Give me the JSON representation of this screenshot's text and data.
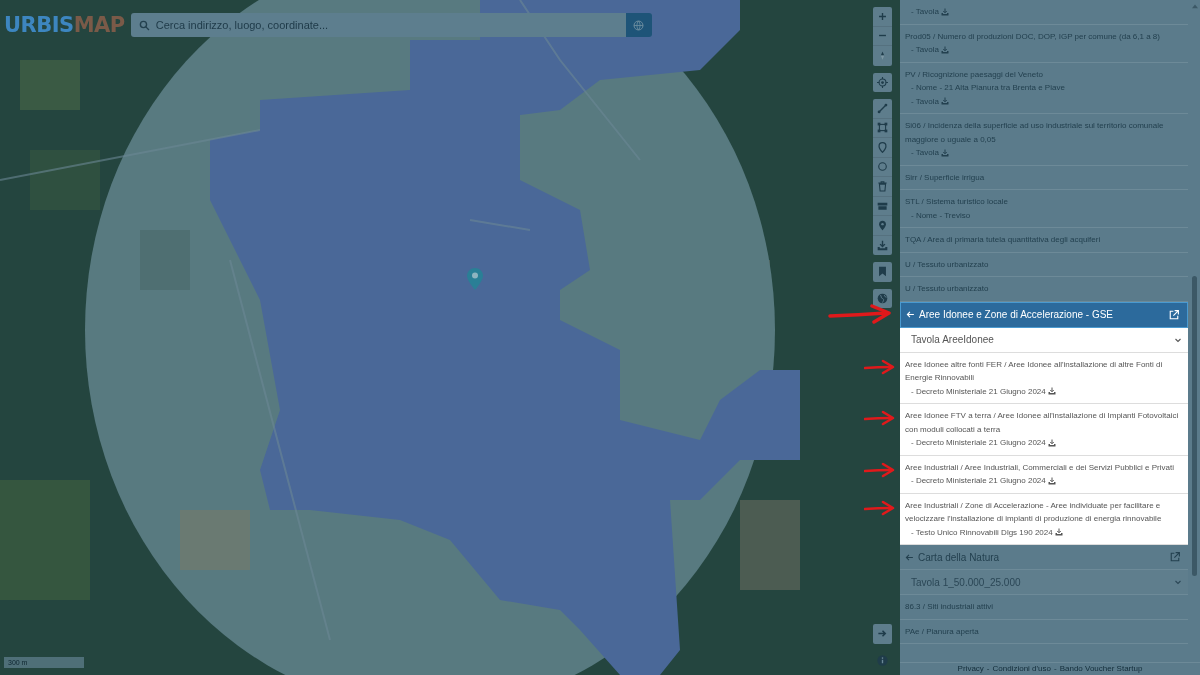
{
  "logo": {
    "parts": [
      {
        "text": "URBIS",
        "color": "#3d86c0"
      },
      {
        "text": "MAP",
        "color": "#7a5a48"
      }
    ]
  },
  "search": {
    "placeholder": "Cerca indirizzo, luogo, coordinate..."
  },
  "scale": "300 m",
  "panel": {
    "items": [
      {
        "details": [
          {
            "text": "- Tavola",
            "download": true
          }
        ]
      },
      {
        "title": "Prod05 / Numero di produzioni DOC, DOP, IGP per comune (da 6,1 a 8)",
        "details": [
          {
            "text": "- Tavola",
            "download": true
          }
        ]
      },
      {
        "title": "PV / Ricognizione paesaggi del Veneto",
        "details": [
          {
            "text": "- Nome - 21 Alta Pianura tra Brenta e Piave",
            "download": false
          },
          {
            "text": "- Tavola",
            "download": true
          }
        ]
      },
      {
        "title": "Si06 / Incidenza della superficie ad uso industriale sul territorio comunale maggiore o uguale a 0,05",
        "details": [
          {
            "text": "- Tavola",
            "download": true
          }
        ]
      },
      {
        "title": "Sirr / Superficie irrigua"
      },
      {
        "title": "STL / Sistema turistico locale",
        "details": [
          {
            "text": "- Nome - Treviso",
            "download": false
          }
        ]
      },
      {
        "title": "TQA / Area di primaria tutela quantitativa degli acquiferi"
      },
      {
        "title": "U / Tessuto urbanizzato"
      },
      {
        "title": "U / Tessuto urbanizzato"
      }
    ],
    "sections": [
      {
        "title": "Aree Idonee e Zone di Accelerazione - GSE",
        "highlighted": true,
        "marked": true,
        "dropdown": "Tavola AreeIdonee",
        "items": [
          {
            "title": "Aree Idonee altre fonti FER / Aree Idonee all'installazione di altre Fonti di Energie Rinnovabili",
            "marked": true,
            "details": [
              {
                "text": "- Decreto Ministeriale 21 Giugno 2024",
                "download": true
              }
            ]
          },
          {
            "title": "Aree Idonee FTV a terra / Aree Idonee all'installazione di Impianti Fotovoltaici con moduli collocati a terra",
            "marked": true,
            "details": [
              {
                "text": "- Decreto Ministeriale 21 Giugno 2024",
                "download": true
              }
            ]
          },
          {
            "title": "Aree Industriali / Aree Industriali, Commerciali e dei Servizi Pubblici e Privati",
            "marked": true,
            "details": [
              {
                "text": "- Decreto Ministeriale 21 Giugno 2024",
                "download": true
              }
            ]
          },
          {
            "title": "Aree Industriali / Zone di Accelerazione - Aree individuate per facilitare e velocizzare l'installazione di impianti di produzione di energia rinnovabile",
            "marked": true,
            "details": [
              {
                "text": "- Testo Unico Rinnovabili Dlgs 190 2024",
                "download": true
              }
            ]
          }
        ]
      },
      {
        "title": "Carta della Natura",
        "highlighted": false,
        "marked": false,
        "dropdown": "Tavola 1_50.000_25.000",
        "items": [
          {
            "title": "86.3 / Siti industriali attivi",
            "marked": false
          },
          {
            "title": "PAe / Pianura aperta",
            "marked": false
          }
        ]
      }
    ]
  },
  "footer": {
    "links": [
      "Privacy",
      "Condizioni d'uso",
      "Bando Voucher Startup"
    ],
    "separator": "-"
  }
}
